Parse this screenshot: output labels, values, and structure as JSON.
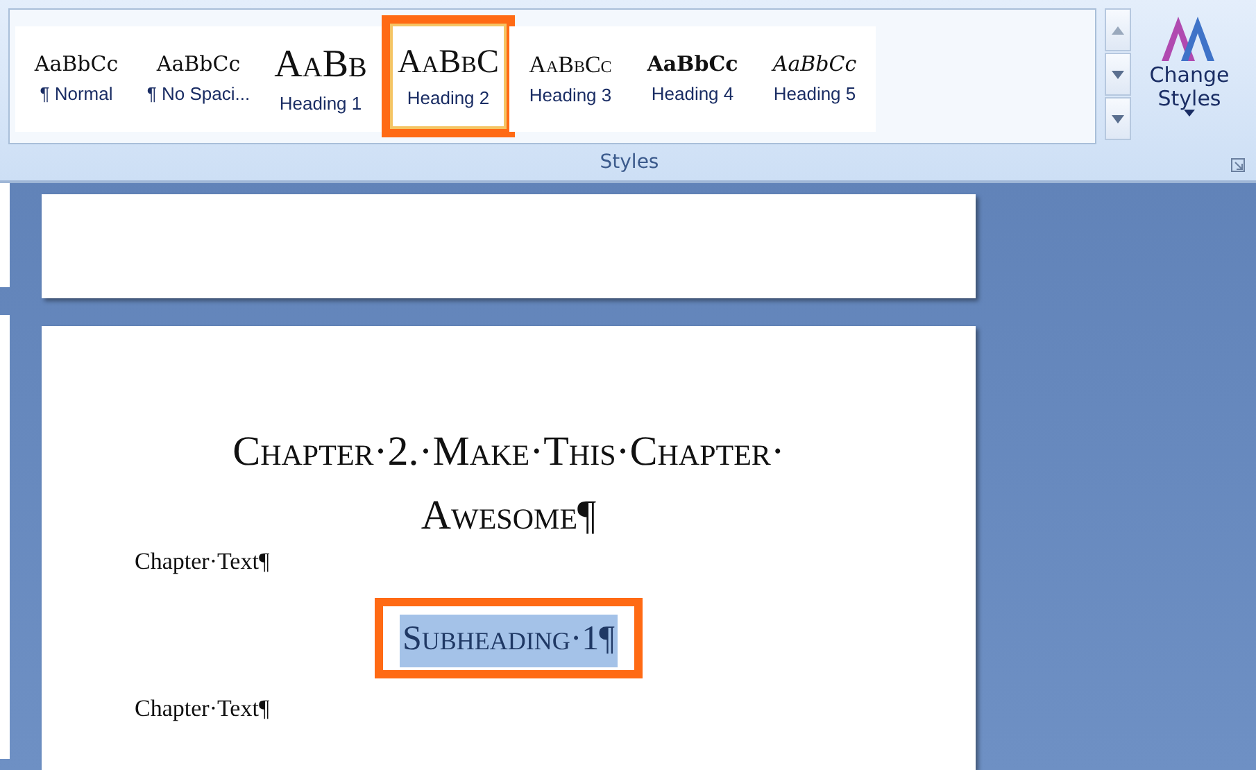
{
  "ribbon": {
    "group_label": "Styles",
    "styles": [
      {
        "preview": "AaBbCc",
        "label": "¶ Normal",
        "kind": "normal",
        "selected": false
      },
      {
        "preview": "AaBbCc",
        "label": "¶ No Spaci...",
        "kind": "normal",
        "selected": false
      },
      {
        "preview": "AaBb",
        "label": "Heading 1",
        "kind": "title",
        "selected": false
      },
      {
        "preview": "AaBbC",
        "label": "Heading 2",
        "kind": "caps",
        "selected": true
      },
      {
        "preview": "AaBbCc",
        "label": "Heading 3",
        "kind": "smallcaps",
        "selected": false
      },
      {
        "preview": "AaBbCc",
        "label": "Heading 4",
        "kind": "bold",
        "selected": false
      },
      {
        "preview": "AaBbCc",
        "label": "Heading 5",
        "kind": "italic",
        "selected": false
      }
    ],
    "change_styles": {
      "label": "Change Styles"
    }
  },
  "document": {
    "paragraphs": [
      {
        "kind": "heading",
        "lines": [
          "Chapter·2.·Make·This·Chapter·",
          "Awesome¶"
        ]
      },
      {
        "kind": "body",
        "text": "Chapter·Text¶"
      },
      {
        "kind": "subheading",
        "text": "Subheading·1¶",
        "selected": true,
        "outlined": true
      },
      {
        "kind": "body",
        "text": "Chapter·Text¶"
      }
    ]
  }
}
